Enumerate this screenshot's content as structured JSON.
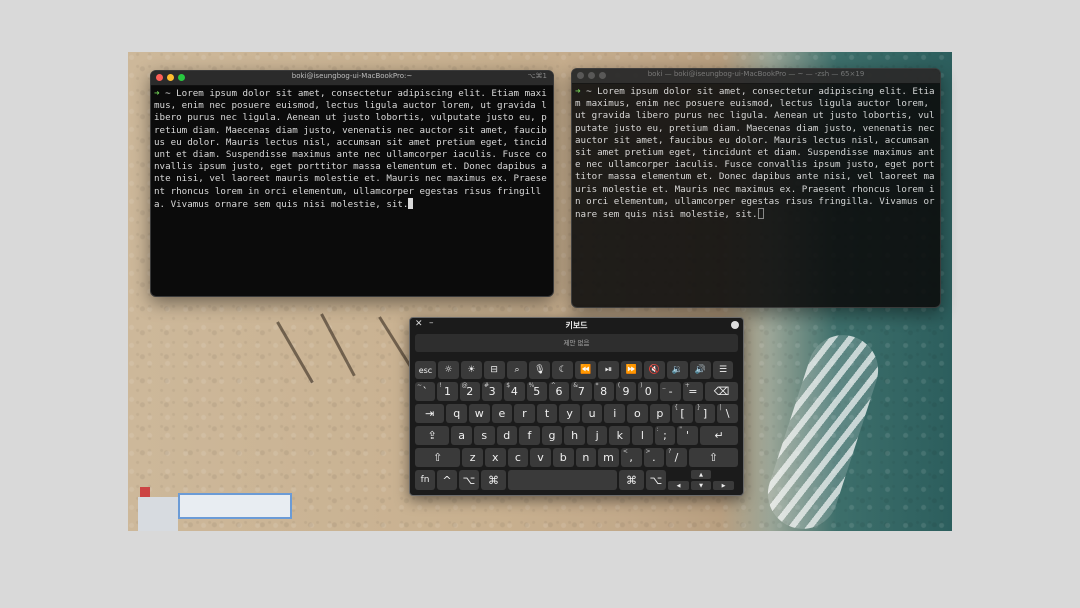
{
  "terminal_left": {
    "title": "boki@iseungbog-ui-MacBookPro:~",
    "shortcut": "⌥⌘1",
    "prompt": "➜",
    "text": " ~ Lorem ipsum dolor sit amet, consectetur adipiscing elit. Etiam maximus, enim nec posuere euismod, lectus ligula auctor lorem, ut gravida libero purus nec ligula. Aenean ut justo lobortis, vulputate justo eu, pretium diam. Maecenas diam justo, venenatis nec auctor sit amet, faucibus eu dolor. Mauris lectus nisl, accumsan sit amet pretium eget, tincidunt et diam. Suspendisse maximus ante nec ullamcorper iaculis. Fusce convallis ipsum justo, eget porttitor massa elementum et. Donec dapibus ante nisi, vel laoreet mauris molestie et. Mauris nec maximus ex. Praesent rhoncus lorem in orci elementum, ullamcorper egestas risus fringilla. Vivamus ornare sem quis nisi molestie, sit."
  },
  "terminal_right": {
    "title": "boki — boki@iseungbog-ui-MacBookPro — ~ — -zsh — 65×19",
    "prompt": "➜",
    "text": " ~ Lorem ipsum dolor sit amet, consectetur adipiscing elit. Etiam maximus, enim nec posuere euismod, lectus ligula auctor lorem, ut gravida libero purus nec ligula. Aenean ut justo lobortis, vulputate justo eu, pretium diam. Maecenas diam justo, venenatis nec auctor sit amet, faucibus eu dolor. Mauris lectus nisl, accumsan sit amet pretium eget, tincidunt et diam. Suspendisse maximus ante nec ullamcorper iaculis. Fusce convallis ipsum justo, eget porttitor massa elementum et. Donec dapibus ante nisi, vel laoreet mauris molestie et. Mauris nec maximus ex. Praesent rhoncus lorem in orci elementum, ullamcorper egestas risus fringilla. Vivamus ornare sem quis nisi molestie, sit."
  },
  "keyboard": {
    "title": "키보드",
    "close": "✕",
    "minimize": "–",
    "suggestion": "제안 없음",
    "function_row": [
      "esc",
      "☼",
      "☀",
      "⊟",
      "⌕",
      "🎙",
      "☾",
      "⏪",
      "⏯",
      "⏩",
      "🔇",
      "🔉",
      "🔊",
      "☰"
    ],
    "number_row": [
      {
        "main": "`",
        "shift": "~"
      },
      {
        "main": "1",
        "shift": "!"
      },
      {
        "main": "2",
        "shift": "@"
      },
      {
        "main": "3",
        "shift": "#"
      },
      {
        "main": "4",
        "shift": "$"
      },
      {
        "main": "5",
        "shift": "%"
      },
      {
        "main": "6",
        "shift": "^"
      },
      {
        "main": "7",
        "shift": "&"
      },
      {
        "main": "8",
        "shift": "*"
      },
      {
        "main": "9",
        "shift": "("
      },
      {
        "main": "0",
        "shift": ")"
      },
      {
        "main": "-",
        "shift": "_"
      },
      {
        "main": "=",
        "shift": "+"
      }
    ],
    "delete": "⌫",
    "tab": "⇥",
    "qwerty_row": [
      "q",
      "w",
      "e",
      "r",
      "t",
      "y",
      "u",
      "i",
      "o",
      "p"
    ],
    "qwerty_extra": [
      {
        "main": "[",
        "shift": "{"
      },
      {
        "main": "]",
        "shift": "}"
      },
      {
        "main": "\\",
        "shift": "|"
      }
    ],
    "caps": "⇪",
    "home_row": [
      "a",
      "s",
      "d",
      "f",
      "g",
      "h",
      "j",
      "k",
      "l"
    ],
    "home_extra": [
      {
        "main": ";",
        "shift": ":"
      },
      {
        "main": "'",
        "shift": "\""
      }
    ],
    "return": "↵",
    "shift": "⇧",
    "bottom_letters": [
      "z",
      "x",
      "c",
      "v",
      "b",
      "n",
      "m"
    ],
    "bottom_extra": [
      {
        "main": ",",
        "shift": "<"
      },
      {
        "main": ".",
        "shift": ">"
      },
      {
        "main": "/",
        "shift": "?"
      }
    ],
    "fn": "fn",
    "control": "^",
    "option": "⌥",
    "command": "⌘",
    "arrow_up": "▲",
    "arrow_left": "◀",
    "arrow_down": "▼",
    "arrow_right": "▶"
  }
}
